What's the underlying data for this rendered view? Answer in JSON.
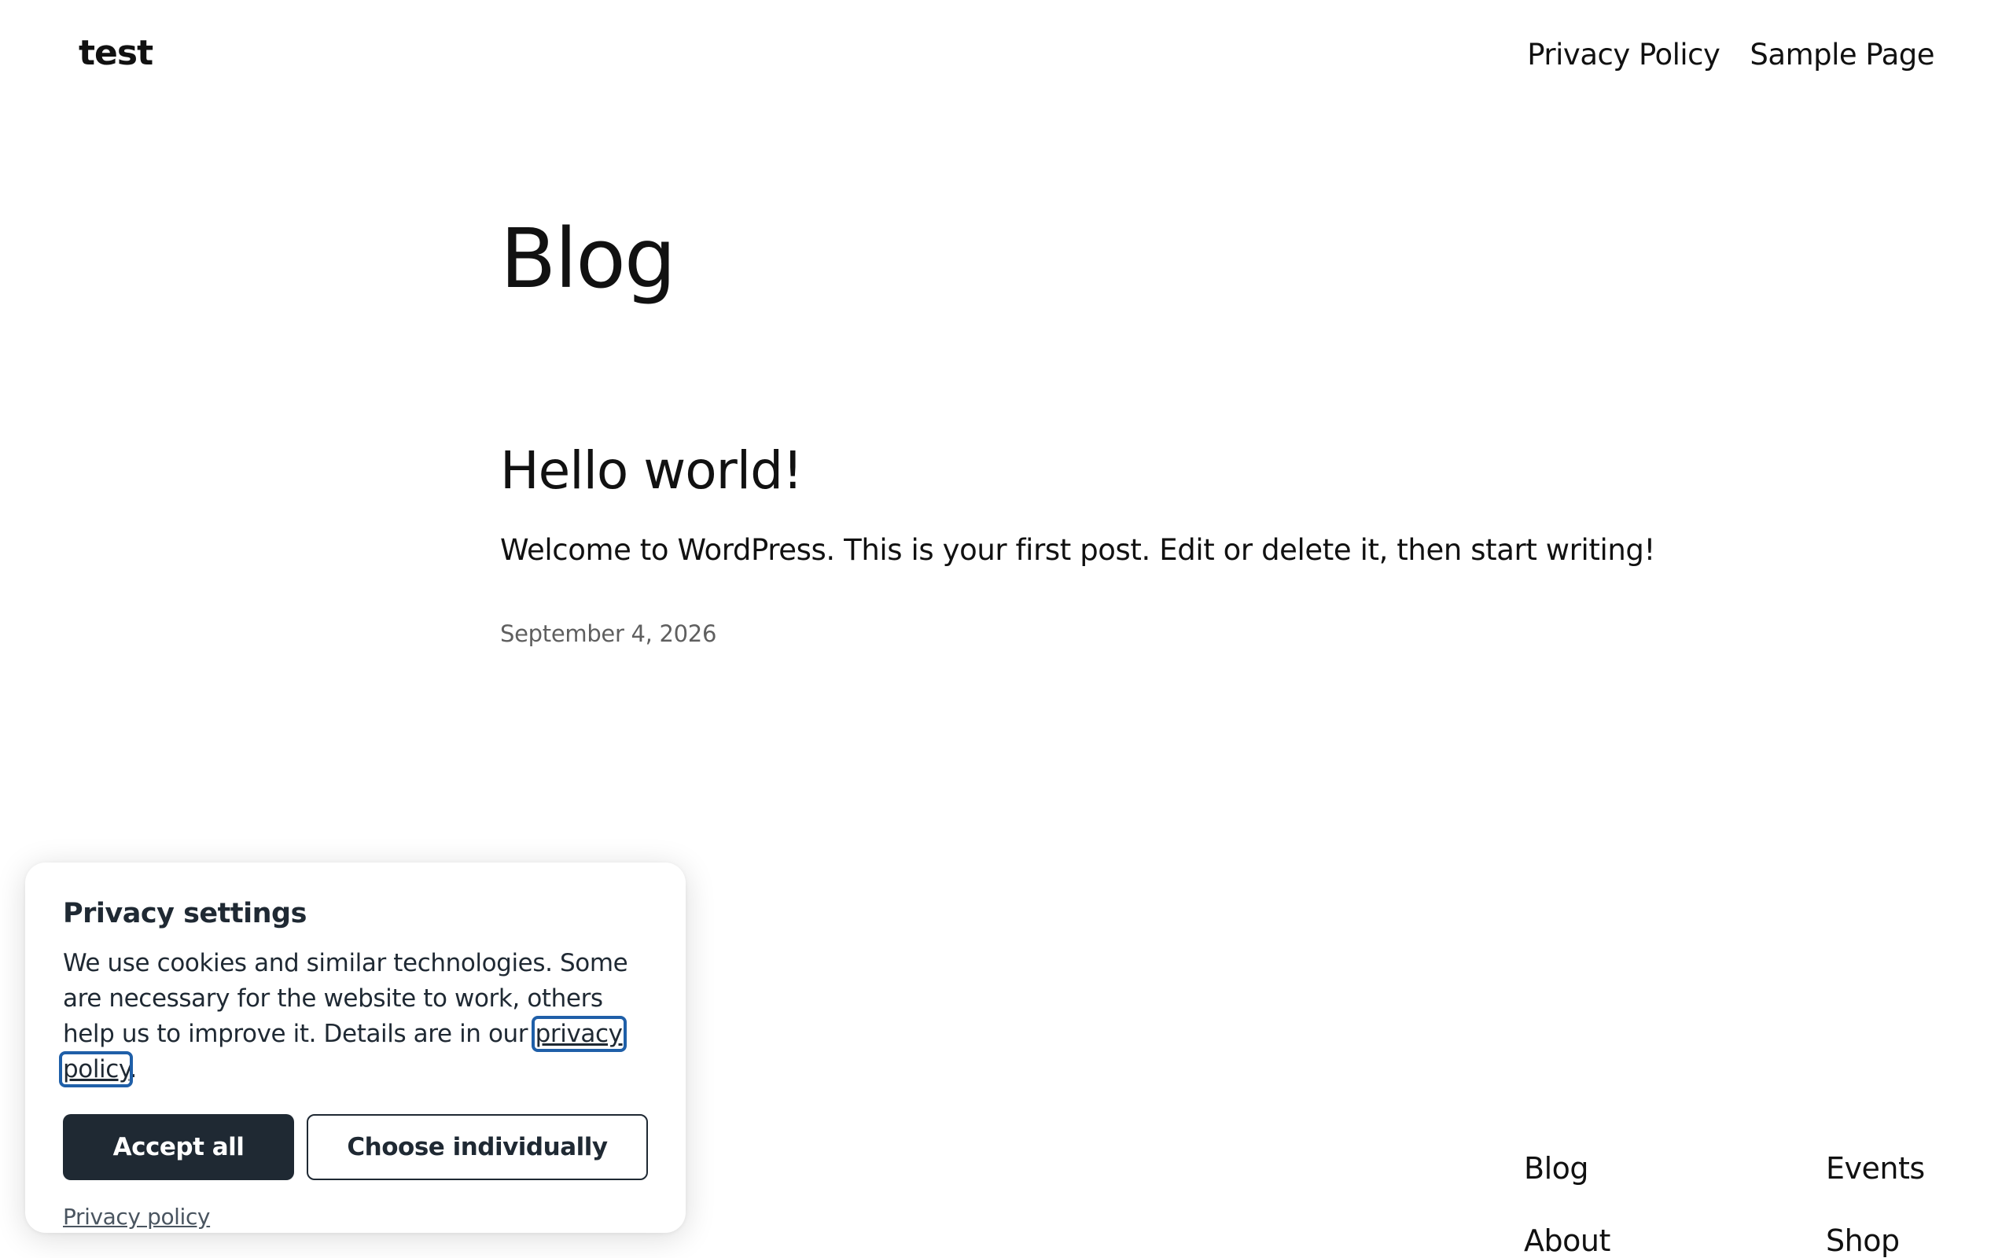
{
  "header": {
    "site_title": "test",
    "nav": [
      {
        "label": "Privacy Policy"
      },
      {
        "label": "Sample Page"
      }
    ]
  },
  "main": {
    "heading": "Blog",
    "posts": [
      {
        "title": "Hello world!",
        "excerpt": "Welcome to WordPress. This is your first post. Edit or delete it, then start writing!",
        "date": "September 4, 2026"
      }
    ]
  },
  "footer": {
    "nav": [
      {
        "label": "Blog"
      },
      {
        "label": "Events"
      },
      {
        "label": "About"
      },
      {
        "label": "Shop"
      }
    ]
  },
  "cookie_banner": {
    "title": "Privacy settings",
    "text_before_link": "We use cookies and similar technologies. Some are necessary for the website to work, others help us to improve it. Details are in our ",
    "inline_link": "privacy policy",
    "text_after_link": ".",
    "accept_label": "Accept all",
    "choose_label": "Choose individually",
    "policy_link": "Privacy policy"
  },
  "colors": {
    "button_dark": "#1f2933",
    "focus_outline": "#1f5fa8",
    "text": "#111111",
    "muted_text": "#5f5f5f"
  }
}
